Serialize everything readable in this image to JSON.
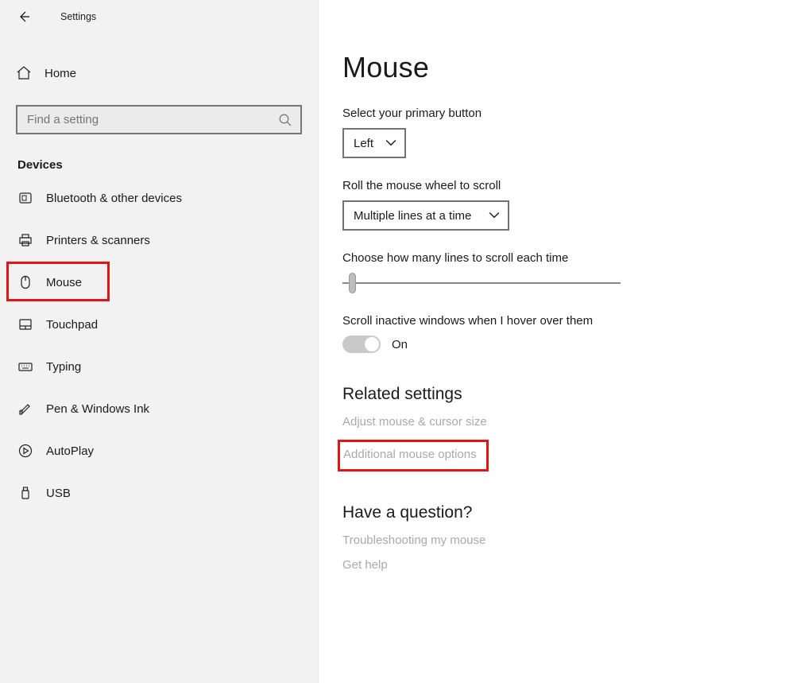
{
  "appTitle": "Settings",
  "home": {
    "label": "Home"
  },
  "search": {
    "placeholder": "Find a setting"
  },
  "categoryHeader": "Devices",
  "nav": [
    {
      "id": "bluetooth",
      "label": "Bluetooth & other devices",
      "highlight": false
    },
    {
      "id": "printers",
      "label": "Printers & scanners",
      "highlight": false
    },
    {
      "id": "mouse",
      "label": "Mouse",
      "highlight": true
    },
    {
      "id": "touchpad",
      "label": "Touchpad",
      "highlight": false
    },
    {
      "id": "typing",
      "label": "Typing",
      "highlight": false
    },
    {
      "id": "pen",
      "label": "Pen & Windows Ink",
      "highlight": false
    },
    {
      "id": "autoplay",
      "label": "AutoPlay",
      "highlight": false
    },
    {
      "id": "usb",
      "label": "USB",
      "highlight": false
    }
  ],
  "page": {
    "title": "Mouse",
    "primaryButton": {
      "label": "Select your primary button",
      "value": "Left"
    },
    "scrollMode": {
      "label": "Roll the mouse wheel to scroll",
      "value": "Multiple lines at a time"
    },
    "linesLabel": "Choose how many lines to scroll each time",
    "hoverScroll": {
      "label": "Scroll inactive windows when I hover over them",
      "state": "On"
    },
    "relatedHeading": "Related settings",
    "relatedLinks": [
      {
        "id": "adjust-size",
        "label": "Adjust mouse & cursor size",
        "highlight": false
      },
      {
        "id": "additional-options",
        "label": "Additional mouse options",
        "highlight": true
      }
    ],
    "questionHeading": "Have a question?",
    "helpLinks": [
      {
        "id": "troubleshoot",
        "label": "Troubleshooting my mouse"
      },
      {
        "id": "get-help",
        "label": "Get help"
      }
    ]
  }
}
